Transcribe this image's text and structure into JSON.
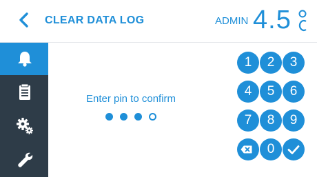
{
  "header": {
    "title": "CLEAR DATA LOG",
    "user": "ADMIN",
    "temperature": "4.5",
    "temperature_unit": "°C"
  },
  "sidebar": {
    "items": [
      {
        "icon": "bell-icon",
        "active": true
      },
      {
        "icon": "clipboard-icon",
        "active": false
      },
      {
        "icon": "gears-icon",
        "active": false
      },
      {
        "icon": "wrench-icon",
        "active": false
      }
    ]
  },
  "main": {
    "prompt": "Enter pin to confirm",
    "pin_digits_entered": 3,
    "pin_length": 4
  },
  "keypad": {
    "keys": [
      "1",
      "2",
      "3",
      "4",
      "5",
      "6",
      "7",
      "8",
      "9",
      "backspace",
      "0",
      "confirm"
    ]
  },
  "colors": {
    "accent": "#1f8fd8",
    "sidebar": "#2e3c48",
    "background": "#ffffff"
  }
}
